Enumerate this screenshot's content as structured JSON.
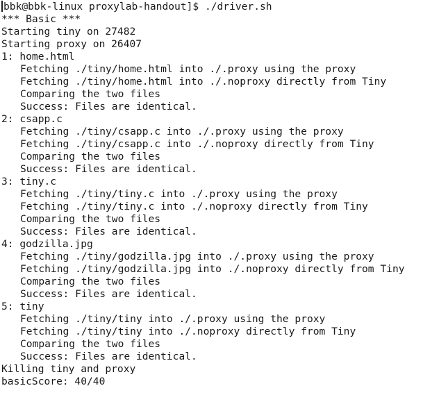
{
  "terminal": {
    "prompt": "bbk@bbk-linux proxylab-handout]$ ./driver.sh",
    "lines": [
      "*** Basic ***",
      "Starting tiny on 27482",
      "Starting proxy on 26407",
      "1: home.html",
      "Fetching ./tiny/home.html into ./.proxy using the proxy",
      "Fetching ./tiny/home.html into ./.noproxy directly from Tiny",
      "Comparing the two files",
      "Success: Files are identical.",
      "2: csapp.c",
      "Fetching ./tiny/csapp.c into ./.proxy using the proxy",
      "Fetching ./tiny/csapp.c into ./.noproxy directly from Tiny",
      "Comparing the two files",
      "Success: Files are identical.",
      "3: tiny.c",
      "Fetching ./tiny/tiny.c into ./.proxy using the proxy",
      "Fetching ./tiny/tiny.c into ./.noproxy directly from Tiny",
      "Comparing the two files",
      "Success: Files are identical.",
      "4: godzilla.jpg",
      "Fetching ./tiny/godzilla.jpg into ./.proxy using the proxy",
      "Fetching ./tiny/godzilla.jpg into ./.noproxy directly from Tiny",
      "Comparing the two files",
      "Success: Files are identical.",
      "5: tiny",
      "Fetching ./tiny/tiny into ./.proxy using the proxy",
      "Fetching ./tiny/tiny into ./.noproxy directly from Tiny",
      "Comparing the two files",
      "Success: Files are identical.",
      "Killing tiny and proxy",
      "basicScore: 40/40"
    ]
  }
}
